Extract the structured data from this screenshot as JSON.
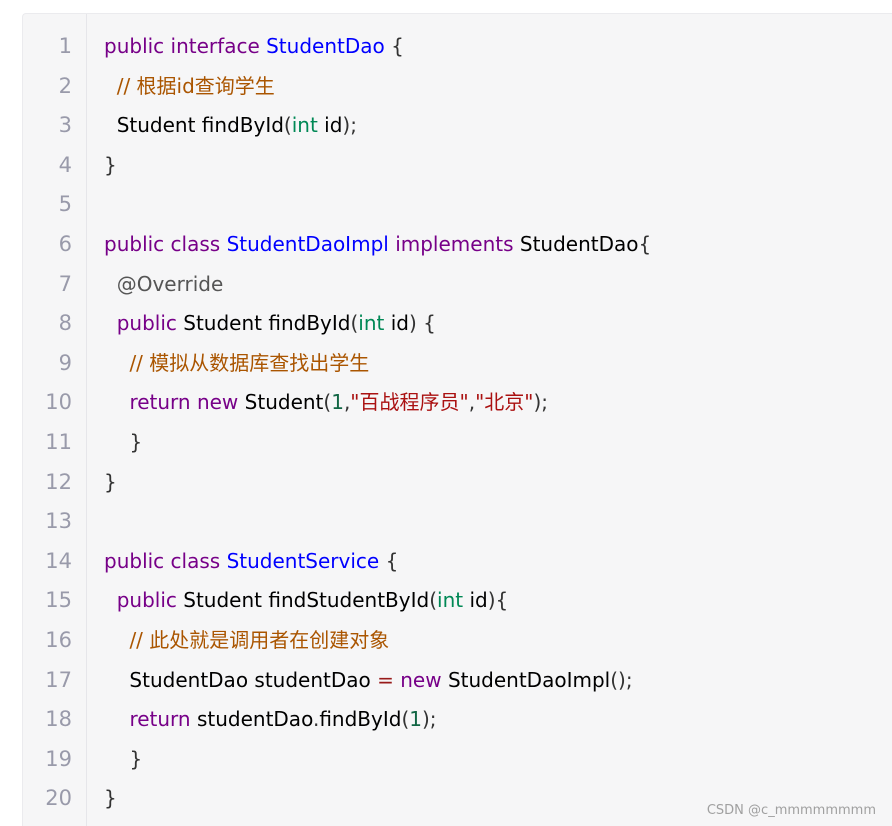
{
  "code": {
    "line_numbers": [
      "1",
      "2",
      "3",
      "4",
      "5",
      "6",
      "7",
      "8",
      "9",
      "10",
      "11",
      "12",
      "13",
      "14",
      "15",
      "16",
      "17",
      "18",
      "19",
      "20"
    ],
    "lines": [
      [
        {
          "text": "public",
          "cls": "k"
        },
        {
          "text": " ",
          "cls": ""
        },
        {
          "text": "interface",
          "cls": "k"
        },
        {
          "text": " ",
          "cls": ""
        },
        {
          "text": "StudentDao",
          "cls": "d"
        },
        {
          "text": " {",
          "cls": "p"
        }
      ],
      [
        {
          "text": "  ",
          "cls": ""
        },
        {
          "text": "// 根据id查询学生",
          "cls": "c"
        }
      ],
      [
        {
          "text": "  Student findById",
          "cls": ""
        },
        {
          "text": "(",
          "cls": "p"
        },
        {
          "text": "int",
          "cls": "t"
        },
        {
          "text": " id",
          "cls": ""
        },
        {
          "text": ");",
          "cls": "p"
        }
      ],
      [
        {
          "text": "}",
          "cls": "p"
        }
      ],
      [],
      [
        {
          "text": "public",
          "cls": "k"
        },
        {
          "text": " ",
          "cls": ""
        },
        {
          "text": "class",
          "cls": "k"
        },
        {
          "text": " ",
          "cls": ""
        },
        {
          "text": "StudentDaoImpl",
          "cls": "d"
        },
        {
          "text": " ",
          "cls": ""
        },
        {
          "text": "implements",
          "cls": "k"
        },
        {
          "text": " StudentDao",
          "cls": ""
        },
        {
          "text": "{",
          "cls": "p"
        }
      ],
      [
        {
          "text": "  ",
          "cls": ""
        },
        {
          "text": "@Override",
          "cls": "m"
        }
      ],
      [
        {
          "text": "  ",
          "cls": ""
        },
        {
          "text": "public",
          "cls": "k"
        },
        {
          "text": " Student findById",
          "cls": ""
        },
        {
          "text": "(",
          "cls": "p"
        },
        {
          "text": "int",
          "cls": "t"
        },
        {
          "text": " id",
          "cls": ""
        },
        {
          "text": ") {",
          "cls": "p"
        }
      ],
      [
        {
          "text": "    ",
          "cls": ""
        },
        {
          "text": "// 模拟从数据库查找出学生",
          "cls": "c"
        }
      ],
      [
        {
          "text": "    ",
          "cls": ""
        },
        {
          "text": "return",
          "cls": "k"
        },
        {
          "text": " ",
          "cls": ""
        },
        {
          "text": "new",
          "cls": "k"
        },
        {
          "text": " Student",
          "cls": ""
        },
        {
          "text": "(",
          "cls": "p"
        },
        {
          "text": "1",
          "cls": "n"
        },
        {
          "text": ",",
          "cls": "p"
        },
        {
          "text": "\"百战程序员\"",
          "cls": "s"
        },
        {
          "text": ",",
          "cls": "p"
        },
        {
          "text": "\"北京\"",
          "cls": "s"
        },
        {
          "text": ");",
          "cls": "p"
        }
      ],
      [
        {
          "text": "    ",
          "cls": ""
        },
        {
          "text": "}",
          "cls": "p"
        }
      ],
      [
        {
          "text": "}",
          "cls": "p"
        }
      ],
      [],
      [
        {
          "text": "public",
          "cls": "k"
        },
        {
          "text": " ",
          "cls": ""
        },
        {
          "text": "class",
          "cls": "k"
        },
        {
          "text": " ",
          "cls": ""
        },
        {
          "text": "StudentService",
          "cls": "d"
        },
        {
          "text": " {",
          "cls": "p"
        }
      ],
      [
        {
          "text": "  ",
          "cls": ""
        },
        {
          "text": "public",
          "cls": "k"
        },
        {
          "text": " Student findStudentById",
          "cls": ""
        },
        {
          "text": "(",
          "cls": "p"
        },
        {
          "text": "int",
          "cls": "t"
        },
        {
          "text": " id",
          "cls": ""
        },
        {
          "text": "){",
          "cls": "p"
        }
      ],
      [
        {
          "text": "    ",
          "cls": ""
        },
        {
          "text": "// 此处就是调用者在创建对象",
          "cls": "c"
        }
      ],
      [
        {
          "text": "    StudentDao studentDao ",
          "cls": ""
        },
        {
          "text": "=",
          "cls": "o"
        },
        {
          "text": " ",
          "cls": ""
        },
        {
          "text": "new",
          "cls": "k"
        },
        {
          "text": " StudentDaoImpl",
          "cls": ""
        },
        {
          "text": "();",
          "cls": "p"
        }
      ],
      [
        {
          "text": "    ",
          "cls": ""
        },
        {
          "text": "return",
          "cls": "k"
        },
        {
          "text": " studentDao",
          "cls": ""
        },
        {
          "text": ".",
          "cls": "p"
        },
        {
          "text": "findById",
          "cls": ""
        },
        {
          "text": "(",
          "cls": "p"
        },
        {
          "text": "1",
          "cls": "n"
        },
        {
          "text": ");",
          "cls": "p"
        }
      ],
      [
        {
          "text": "    ",
          "cls": ""
        },
        {
          "text": "}",
          "cls": "p"
        }
      ],
      [
        {
          "text": "}",
          "cls": "p"
        }
      ]
    ]
  },
  "watermark": "CSDN @c_mmmmmmmm"
}
